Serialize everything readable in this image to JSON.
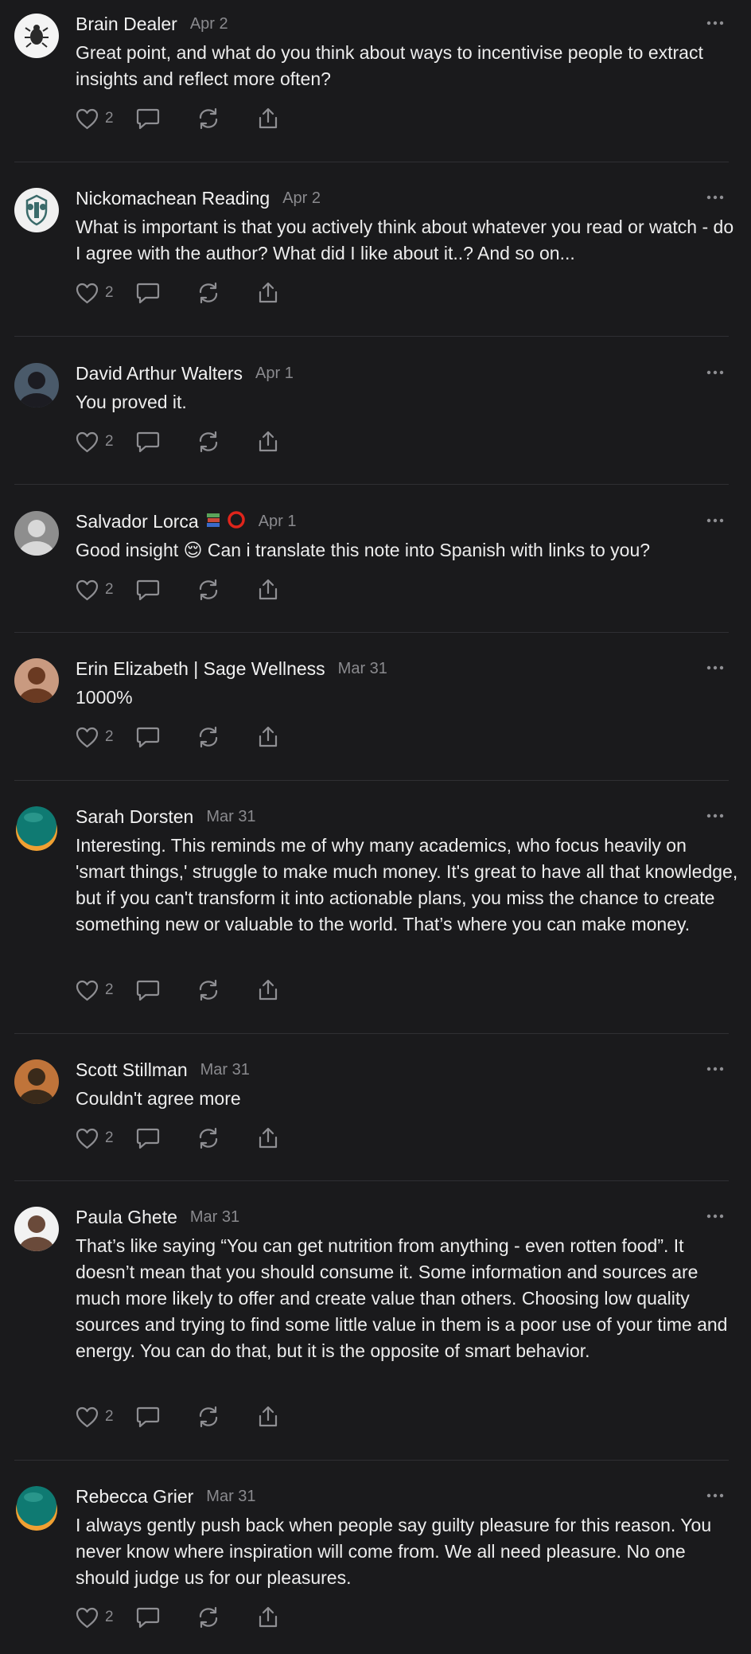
{
  "comments": [
    {
      "author": "Brain Dealer",
      "date": "Apr 2",
      "body": "Great point, and what do you think about ways to incentivise people to extract insights and reflect more often?",
      "like_count": "2",
      "avatar_icon": "bug-avatar-icon",
      "colors": {
        "bg": "#f4f4f4",
        "fg": "#2a2a2a"
      }
    },
    {
      "author": "Nickomachean Reading",
      "date": "Apr 2",
      "body": "What is important is that you actively think about whatever you read or watch - do I agree with the author? What did I like about it..? And so on...",
      "like_count": "2",
      "avatar_icon": "crest-avatar-icon",
      "colors": {
        "bg": "#f0f0f0",
        "fg": "#3a6a6a"
      }
    },
    {
      "author": "David Arthur Walters",
      "date": "Apr 1",
      "body": "You proved it.",
      "like_count": "2",
      "avatar_icon": "photo-avatar-icon",
      "colors": {
        "bg": "#4a5a6a",
        "fg": "#1c1c22"
      }
    },
    {
      "author": "Salvador Lorca",
      "badges": [
        "books-badge-icon",
        "red-circle-badge-icon"
      ],
      "date": "Apr 1",
      "body": "Good insight 😌 Can i translate this note into Spanish with links to you?",
      "like_count": "2",
      "avatar_icon": "photo-avatar-icon",
      "colors": {
        "bg": "#8e8e8e",
        "fg": "#d8d8d8"
      }
    },
    {
      "author": "Erin Elizabeth | Sage Wellness",
      "date": "Mar 31",
      "body": "1000%",
      "like_count": "2",
      "avatar_icon": "photo-avatar-icon",
      "colors": {
        "bg": "#c99a80",
        "fg": "#6a3a22"
      }
    },
    {
      "author": "Sarah Dorsten",
      "date": "Mar 31",
      "body": "Interesting. This reminds me of why many academics, who focus heavily on 'smart things,' struggle to make much money. It's great to have all that knowledge, but if you can't transform it into actionable plans, you miss the chance to create something new or valuable to the world. That’s where you can make money.",
      "like_count": "2",
      "avatar_icon": "planet-avatar-icon",
      "colors": {
        "bg": "#0f7a72",
        "fg": "#f0a032"
      }
    },
    {
      "author": "Scott Stillman",
      "date": "Mar 31",
      "body": "Couldn't agree more",
      "like_count": "2",
      "avatar_icon": "photo-avatar-icon",
      "colors": {
        "bg": "#c0743a",
        "fg": "#3a2a1a"
      }
    },
    {
      "author": "Paula Ghete",
      "date": "Mar 31",
      "body": "That’s like saying “You can get nutrition from anything - even rotten food”. It doesn’t mean that you should consume it. Some information and sources are much more likely to offer and create value than others. Choosing low quality sources and trying to find some little value in them is a poor use of your time and energy. You can do that, but it is the opposite of smart behavior.",
      "like_count": "2",
      "avatar_icon": "photo-avatar-icon",
      "colors": {
        "bg": "#f2f2f2",
        "fg": "#6a4a3a"
      }
    },
    {
      "author": "Rebecca Grier",
      "date": "Mar 31",
      "body": "I always gently push back when people say guilty pleasure for this reason. You never know where inspiration will come from. We all need pleasure. No one should judge us for our pleasures.",
      "like_count": "2",
      "avatar_icon": "planet-avatar-icon",
      "colors": {
        "bg": "#0f7a72",
        "fg": "#f0a032"
      }
    }
  ],
  "icons": {
    "more": "more-options-icon",
    "like": "heart-icon",
    "reply": "comment-bubble-icon",
    "restack": "restack-icon",
    "share": "share-icon"
  },
  "theme": {
    "background": "#1a1a1c",
    "text": "#f2f2f2",
    "muted": "#8a8a8e",
    "divider": "#2f2f33"
  }
}
